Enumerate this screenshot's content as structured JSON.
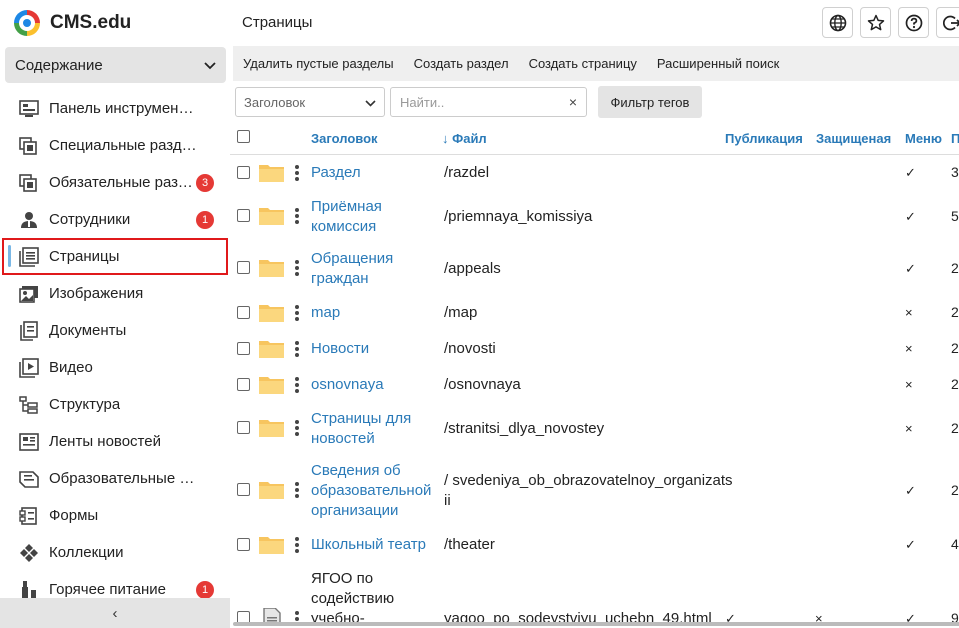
{
  "app": {
    "name": "CMS.edu"
  },
  "sidebar": {
    "section_select": "Содержание",
    "items": [
      {
        "label": "Панель инструментов",
        "icon": "dashboard-icon"
      },
      {
        "label": "Специальные разделы",
        "icon": "stack-icon"
      },
      {
        "label": "Обязательные разделы",
        "icon": "stack-icon",
        "badge": "3"
      },
      {
        "label": "Сотрудники",
        "icon": "person-icon",
        "badge": "1"
      },
      {
        "label": "Страницы",
        "icon": "pages-icon",
        "active": true
      },
      {
        "label": "Изображения",
        "icon": "images-icon"
      },
      {
        "label": "Документы",
        "icon": "documents-icon"
      },
      {
        "label": "Видео",
        "icon": "video-icon"
      },
      {
        "label": "Структура",
        "icon": "structure-icon"
      },
      {
        "label": "Ленты новостей",
        "icon": "newsfeed-icon"
      },
      {
        "label": "Образовательные программы",
        "icon": "education-icon"
      },
      {
        "label": "Формы",
        "icon": "forms-icon"
      },
      {
        "label": "Коллекции",
        "icon": "collections-icon"
      },
      {
        "label": "Горячее питание",
        "icon": "food-icon",
        "badge": "1"
      }
    ],
    "collapse_label": "‹"
  },
  "header": {
    "title": "Страницы"
  },
  "toolbar": {
    "actions": [
      "Удалить пустые разделы",
      "Создать раздел",
      "Создать страницу",
      "Расширенный поиск"
    ]
  },
  "filters": {
    "field_select": "Заголовок",
    "search_placeholder": "Найти..",
    "clear_label": "×",
    "tag_filter_label": "Фильтр тегов"
  },
  "table": {
    "columns": [
      "Заголовок",
      "↓ Файл",
      "Публикация",
      "Защищеная",
      "Меню",
      "П"
    ],
    "rows": [
      {
        "title": "Раздел",
        "file": "/razdel",
        "menu": "✓",
        "extra": "3"
      },
      {
        "title": "Приёмная комиссия",
        "file": "/priemnaya_komissiya",
        "menu": "✓",
        "extra": "5"
      },
      {
        "title": "Обращения граждан",
        "file": "/appeals",
        "menu": "✓",
        "extra": "2"
      },
      {
        "title": "map",
        "file": "/map",
        "menu": "×",
        "extra": "2"
      },
      {
        "title": "Новости",
        "file": "/novosti",
        "menu": "×",
        "extra": "2"
      },
      {
        "title": "osnovnaya",
        "file": "/osnovnaya",
        "menu": "×",
        "extra": "2"
      },
      {
        "title": "Страницы для новостей",
        "file": "/stranitsi_dlya_novostey",
        "menu": "×",
        "extra": "2"
      },
      {
        "title": "Сведения об образовательной организации",
        "file": "/ svedeniya_ob_obrazovatelnoy_organizatsii",
        "menu": "✓",
        "extra": "2"
      },
      {
        "title": "Школьный театр",
        "file": "/theater",
        "menu": "✓",
        "extra": "4"
      },
      {
        "title": "ЯГОО по содействию учебно-",
        "file": "yagoo_po_sodeystviyu_uchebn_49.html",
        "publication": "✓",
        "protected": "×",
        "menu": "✓",
        "extra": "9"
      }
    ]
  },
  "colors": {
    "link": "#2a7ab8",
    "badge": "#e53935",
    "highlight": "#e0191b",
    "folder": "#f7c55f"
  }
}
